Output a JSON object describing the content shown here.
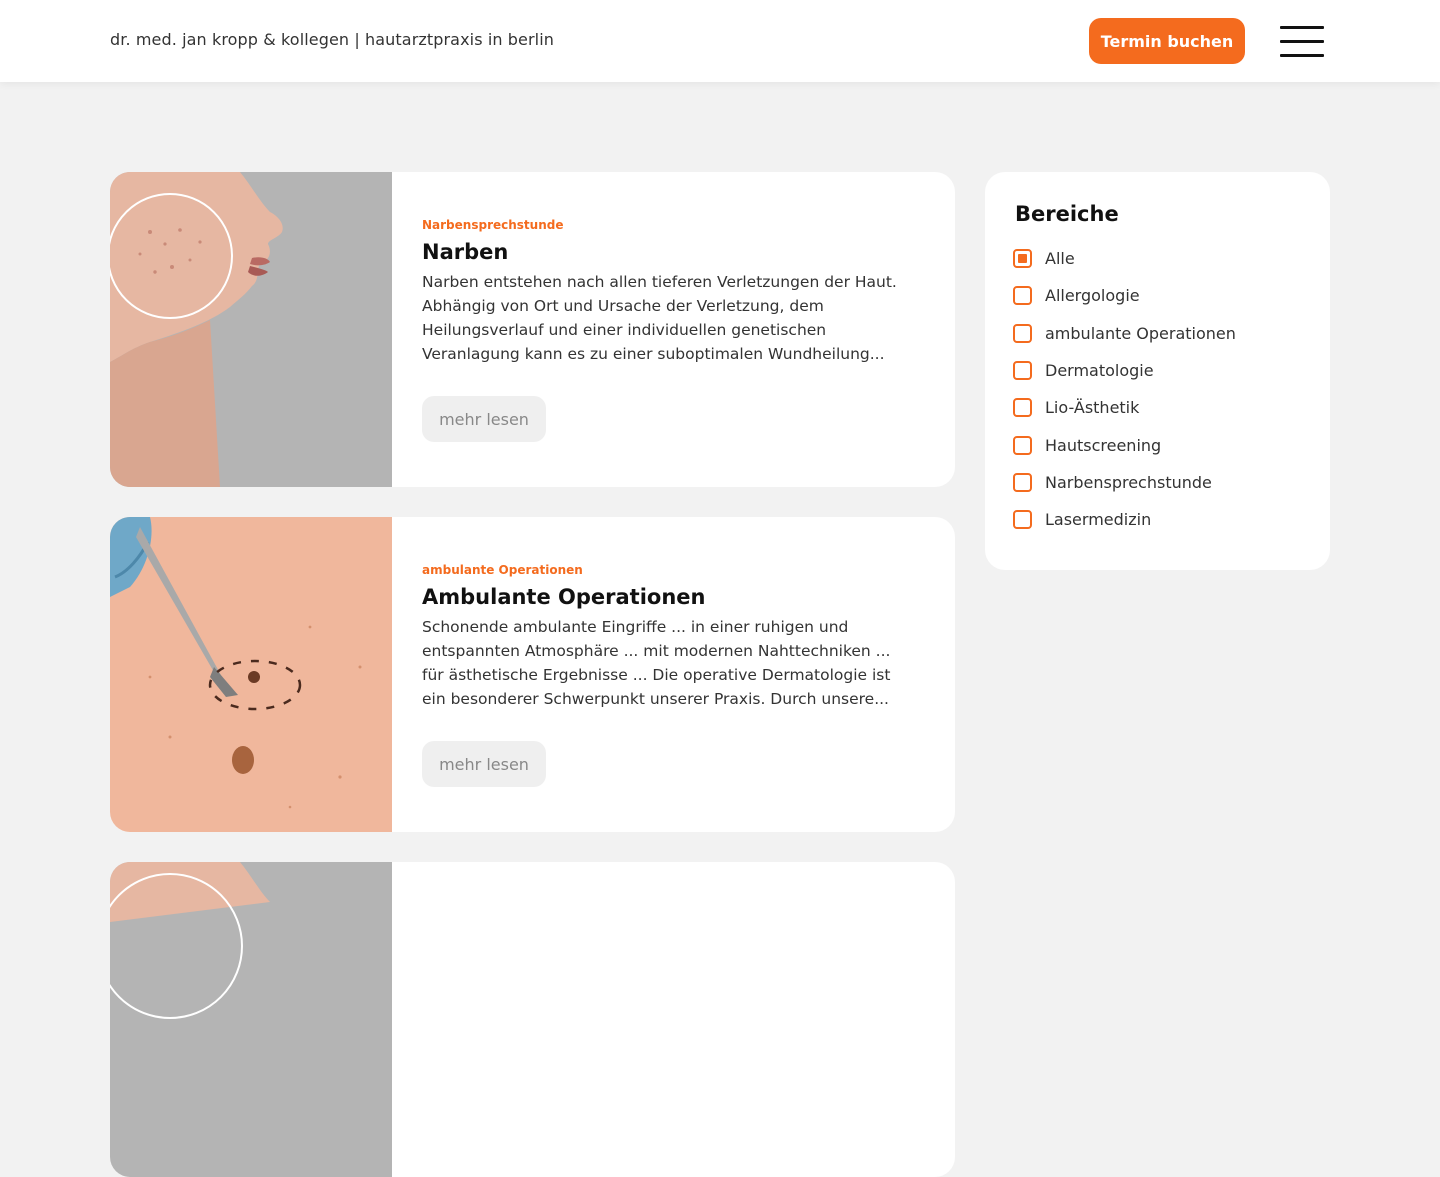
{
  "header": {
    "brand": "dr. med. jan kropp & kollegen | hautarztpraxis in berlin",
    "book_label": "Termin buchen",
    "menu_icon": "hamburger-menu-icon"
  },
  "articles": [
    {
      "category": "Narbensprechstunde",
      "title": "Narben",
      "excerpt": "Narben entstehen nach allen tieferen Verletzungen der Haut. Abhängig von Ort und Ursache der Verletzung, dem Heilungsverlauf und einer individuellen genetischen Veranlagung kann es zu einer suboptimalen Wundheilung...",
      "more_label": "mehr lesen"
    },
    {
      "category": "ambulante Operationen",
      "title": "Ambulante Operationen",
      "excerpt": "Schonende ambulante Eingriffe ... in einer ruhigen und entspannten Atmosphäre ... mit modernen Nahttechniken ...  für ästhetische Ergebnisse ... Die operative Dermatologie ist ein besonderer Schwerpunkt unserer Praxis. Durch unsere...",
      "more_label": "mehr lesen"
    }
  ],
  "filter": {
    "title": "Bereiche",
    "items": [
      {
        "label": "Alle",
        "checked": true
      },
      {
        "label": "Allergologie",
        "checked": false
      },
      {
        "label": "ambulante Operationen",
        "checked": false
      },
      {
        "label": "Dermatologie",
        "checked": false
      },
      {
        "label": "Lio-Ästhetik",
        "checked": false
      },
      {
        "label": "Hautscreening",
        "checked": false
      },
      {
        "label": "Narbensprechstunde",
        "checked": false
      },
      {
        "label": "Lasermedizin",
        "checked": false
      }
    ]
  },
  "colors": {
    "accent": "#f46b1e",
    "background": "#f2f2f2",
    "card": "#ffffff"
  }
}
